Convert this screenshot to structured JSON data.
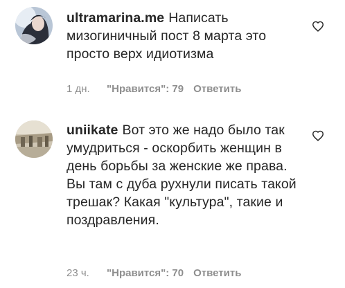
{
  "comments": [
    {
      "username": "ultramarina.me",
      "text": "Написать мизогиничный пост 8 марта это просто верх идиотизма",
      "time": "1 дн.",
      "likes": "\"Нравится\": 79",
      "reply_label": "Ответить"
    },
    {
      "username": "uniikate",
      "text": "Вот это же надо было так умудриться - оскорбить женщин в день борьбы за женские же права. Вы там с дуба рухнули писать такой трешак? Какая \"культура\", такие и поздравления.",
      "time": "23 ч.",
      "likes": "\"Нравится\": 70",
      "reply_label": "Ответить"
    }
  ],
  "icons": {
    "like": "heart-outline-icon",
    "avatar": "avatar-image"
  },
  "colors": {
    "text": "#262626",
    "meta": "#8e8e8e",
    "background": "#ffffff"
  }
}
